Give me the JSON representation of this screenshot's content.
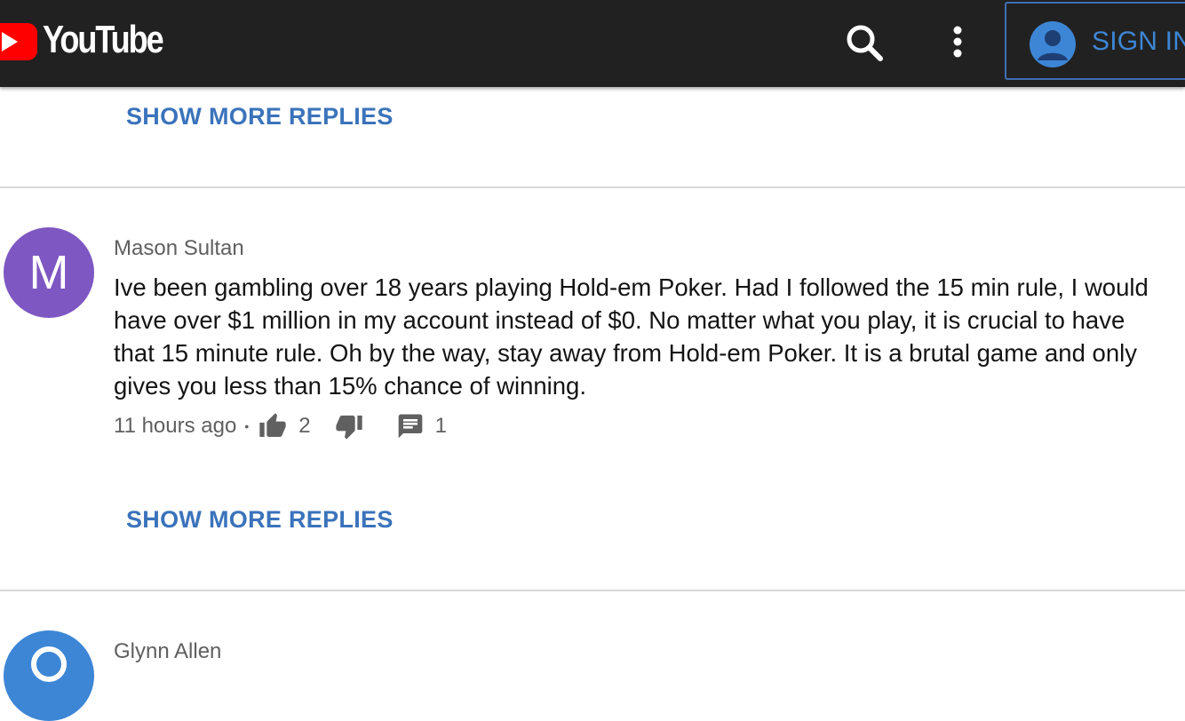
{
  "header": {
    "logo_text": "YouTube",
    "search_icon": "search-icon",
    "more_icon": "more-vert-icon",
    "sign_in_label": "SIGN IN",
    "colors": {
      "bar": "#212121",
      "logo_red": "#ff0000",
      "sign_in_blue": "#3d86d6"
    }
  },
  "thread_top": {
    "show_more_replies": "SHOW MORE REPLIES"
  },
  "comments": [
    {
      "avatar_letter": "M",
      "avatar_color": "#7e57c2",
      "author": "Mason Sultan",
      "text": "Ive been gambling over 18 years playing Hold-em Poker. Had I followed the 15 min rule, I would have over $1 million in my account instead of $0. No matter what you play, it is crucial to have that 15 minute rule. Oh by the way, stay away from Hold-em Poker. It is a brutal game and only gives you less than 15% chance of winning.",
      "time": "11 hours ago",
      "separator": "•",
      "likes": "2",
      "replies_count": "1",
      "show_more_replies": "SHOW MORE REPLIES"
    },
    {
      "avatar_color": "#3d86d6",
      "author": "Glynn Allen"
    }
  ]
}
